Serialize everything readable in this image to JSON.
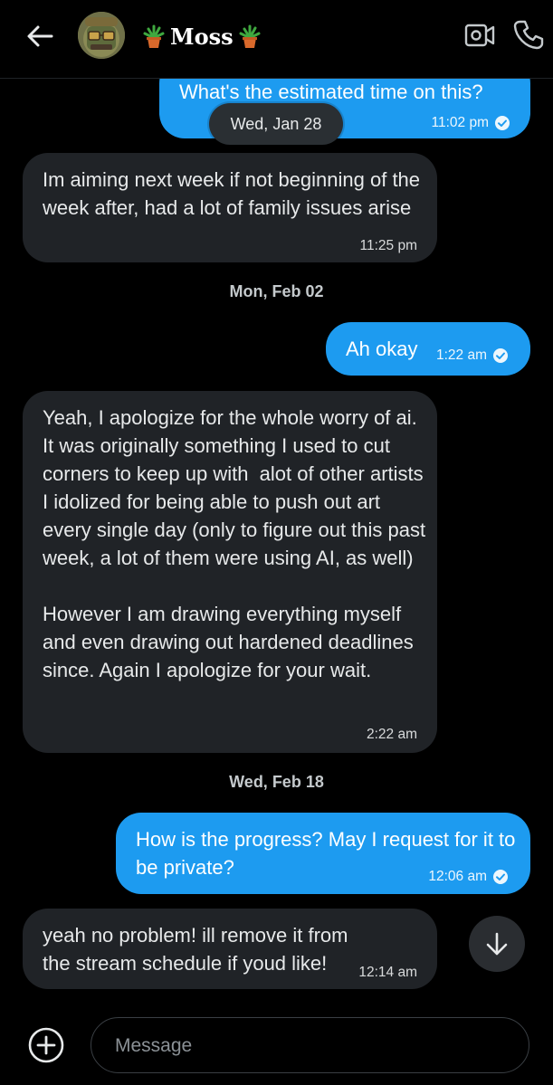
{
  "header": {
    "contact_name": "Moss",
    "left_emoji": "potted-plant-icon",
    "right_emoji": "potted-plant-icon"
  },
  "messages": [
    {
      "direction": "out",
      "text": "What's the estimated time on this?",
      "time": "11:02 pm",
      "read": true
    },
    {
      "direction": "in",
      "text": "Im aiming next week if not beginning of the week after, had a lot of family issues arise",
      "time": "11:25 pm"
    },
    {
      "direction": "out",
      "text": "Ah okay",
      "time": "1:22 am",
      "read": true
    },
    {
      "direction": "in",
      "text": "Yeah, I apologize for the whole worry of ai. It was originally something I used to cut corners to keep up with  alot of other artists I idolized for being able to push out art every single day (only to figure out this past week, a lot of them were using AI, as well)\n\nHowever I am drawing everything myself and even drawing out hardened deadlines since. Again I apologize for your wait.",
      "time": "2:22 am"
    },
    {
      "direction": "out",
      "text": "How is the progress? May I request for it to be private?",
      "time": "12:06 am",
      "read": true
    },
    {
      "direction": "in",
      "text": "yeah no problem! ill remove it from the stream schedule if youd like!",
      "time": "12:14 am"
    }
  ],
  "date_separators": {
    "floating": "Wed, Jan 28",
    "feb02": "Mon, Feb 02",
    "feb18": "Wed, Feb 18"
  },
  "composer": {
    "placeholder": "Message"
  },
  "colors": {
    "outgoing_bubble": "#1d9bf0",
    "incoming_bubble": "#202327",
    "background": "#000000"
  }
}
